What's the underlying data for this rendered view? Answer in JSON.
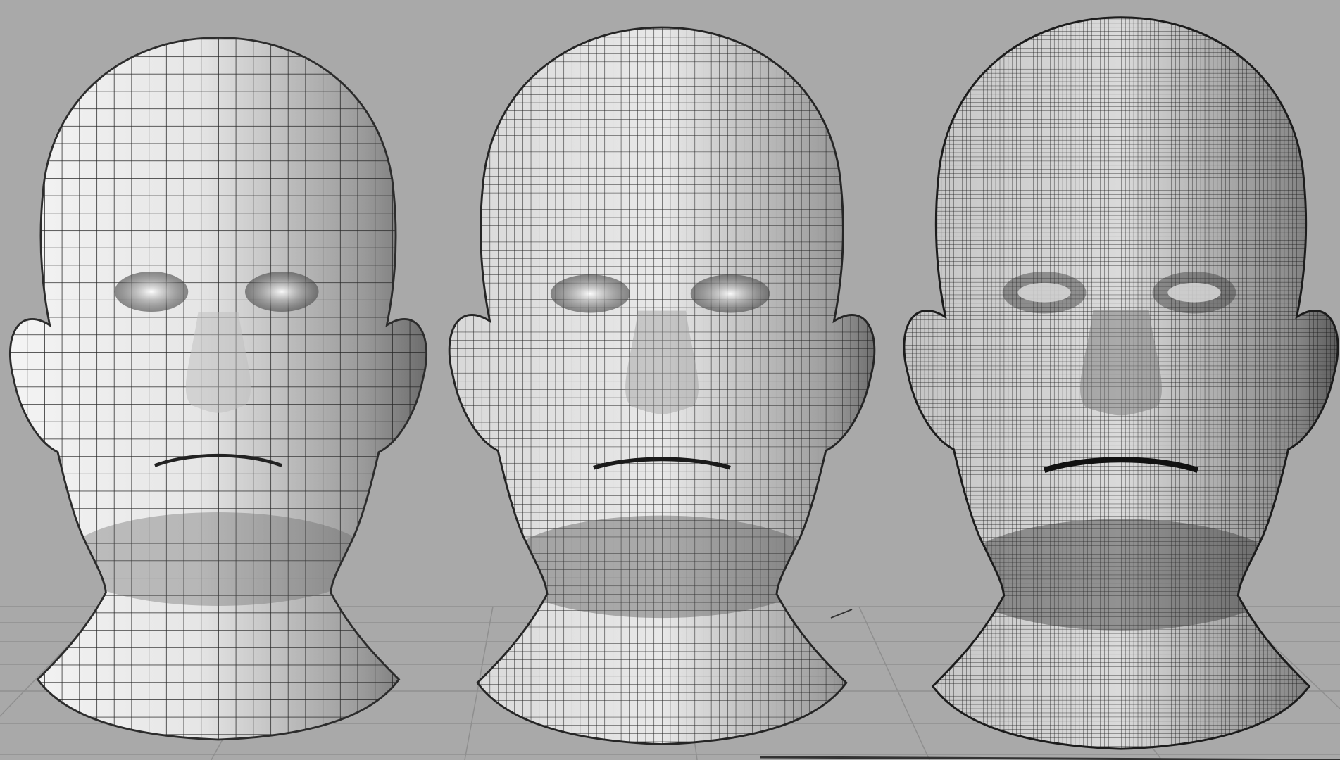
{
  "viewport": {
    "background_color": "#a9a9a9",
    "grid_line_color": "#8f8f8f",
    "ground_grid_visible": true
  },
  "models": [
    {
      "name": "low-subdivision-head",
      "skin_color": "#ececec",
      "shadow_color": "#7d7d7d",
      "wire_color": "#262626",
      "wire_density": "low"
    },
    {
      "name": "medium-subdivision-head",
      "skin_color": "#e4e4e4",
      "shadow_color": "#767676",
      "wire_color": "#1e1e1e",
      "wire_density": "medium"
    },
    {
      "name": "high-subdivision-head",
      "skin_color": "#d4d4d4",
      "shadow_color": "#5a5a5a",
      "wire_color": "#141414",
      "wire_density": "high"
    }
  ]
}
